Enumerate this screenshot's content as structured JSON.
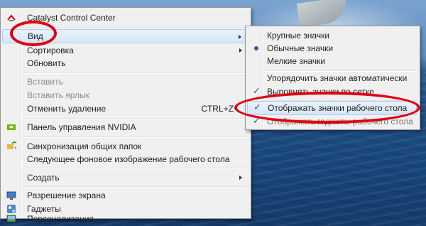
{
  "main_menu": {
    "items": [
      {
        "label": "Catalyst Control Center",
        "icon": "catalyst-icon"
      },
      {
        "label": "Вид"
      },
      {
        "label": "Сортировка"
      },
      {
        "label": "Обновить"
      },
      {
        "label": "Вставить",
        "disabled": true
      },
      {
        "label": "Вставить ярлык",
        "disabled": true
      },
      {
        "label": "Отменить удаление",
        "shortcut": "CTRL+Z"
      },
      {
        "label": "Панель управления NVIDIA",
        "icon": "nvidia-icon"
      },
      {
        "label": "Синхронизация общих папок",
        "icon": "sync-icon"
      },
      {
        "label": "Следующее фоновое изображение рабочего стола"
      },
      {
        "label": "Создать"
      },
      {
        "label": "Разрешение экрана",
        "icon": "display-icon"
      },
      {
        "label": "Гаджеты",
        "icon": "gadgets-icon"
      },
      {
        "label": "Персонализация",
        "icon": "personalize-icon"
      }
    ]
  },
  "view_submenu": {
    "items": [
      {
        "label": "Крупные значки"
      },
      {
        "label": "Обычные значки",
        "selected": true
      },
      {
        "label": "Мелкие значки"
      },
      {
        "label": "Упорядочить значки автоматически"
      },
      {
        "label": "Выровнять значки по сетке",
        "checked": true
      },
      {
        "label": "Отображать значки рабочего стола",
        "checked": true
      },
      {
        "label": "Отображать гаджеты рабочего стола",
        "checked": true
      }
    ]
  },
  "colors": {
    "highlight_oval": "#e10010",
    "menu_bg": "#f0f0f0",
    "check": "#2b5aa9"
  }
}
